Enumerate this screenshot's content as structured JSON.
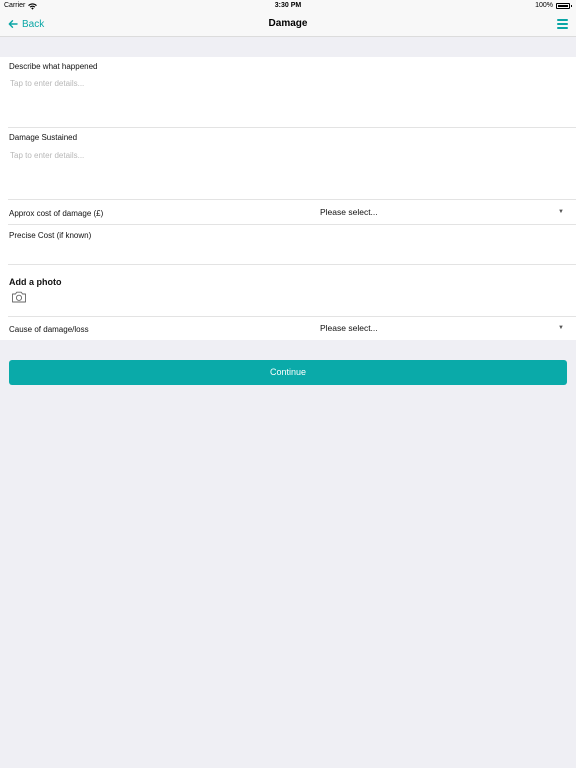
{
  "status_bar": {
    "carrier": "Carrier",
    "time": "3:30 PM",
    "battery": "100%"
  },
  "nav": {
    "back_label": "Back",
    "title": "Damage"
  },
  "form": {
    "describe": {
      "label": "Describe what happened",
      "placeholder": "Tap to enter details..."
    },
    "damage_sustained": {
      "label": "Damage Sustained",
      "placeholder": "Tap to enter details..."
    },
    "approx_cost": {
      "label": "Approx cost of damage (£)",
      "value": "Please select..."
    },
    "precise_cost": {
      "label": "Precise Cost (if known)",
      "value": ""
    },
    "photo": {
      "title": "Add a photo"
    },
    "cause": {
      "label": "Cause of damage/loss",
      "value": "Please select..."
    }
  },
  "continue_label": "Continue",
  "colors": {
    "accent": "#0aa6a6",
    "background": "#efeff4"
  }
}
